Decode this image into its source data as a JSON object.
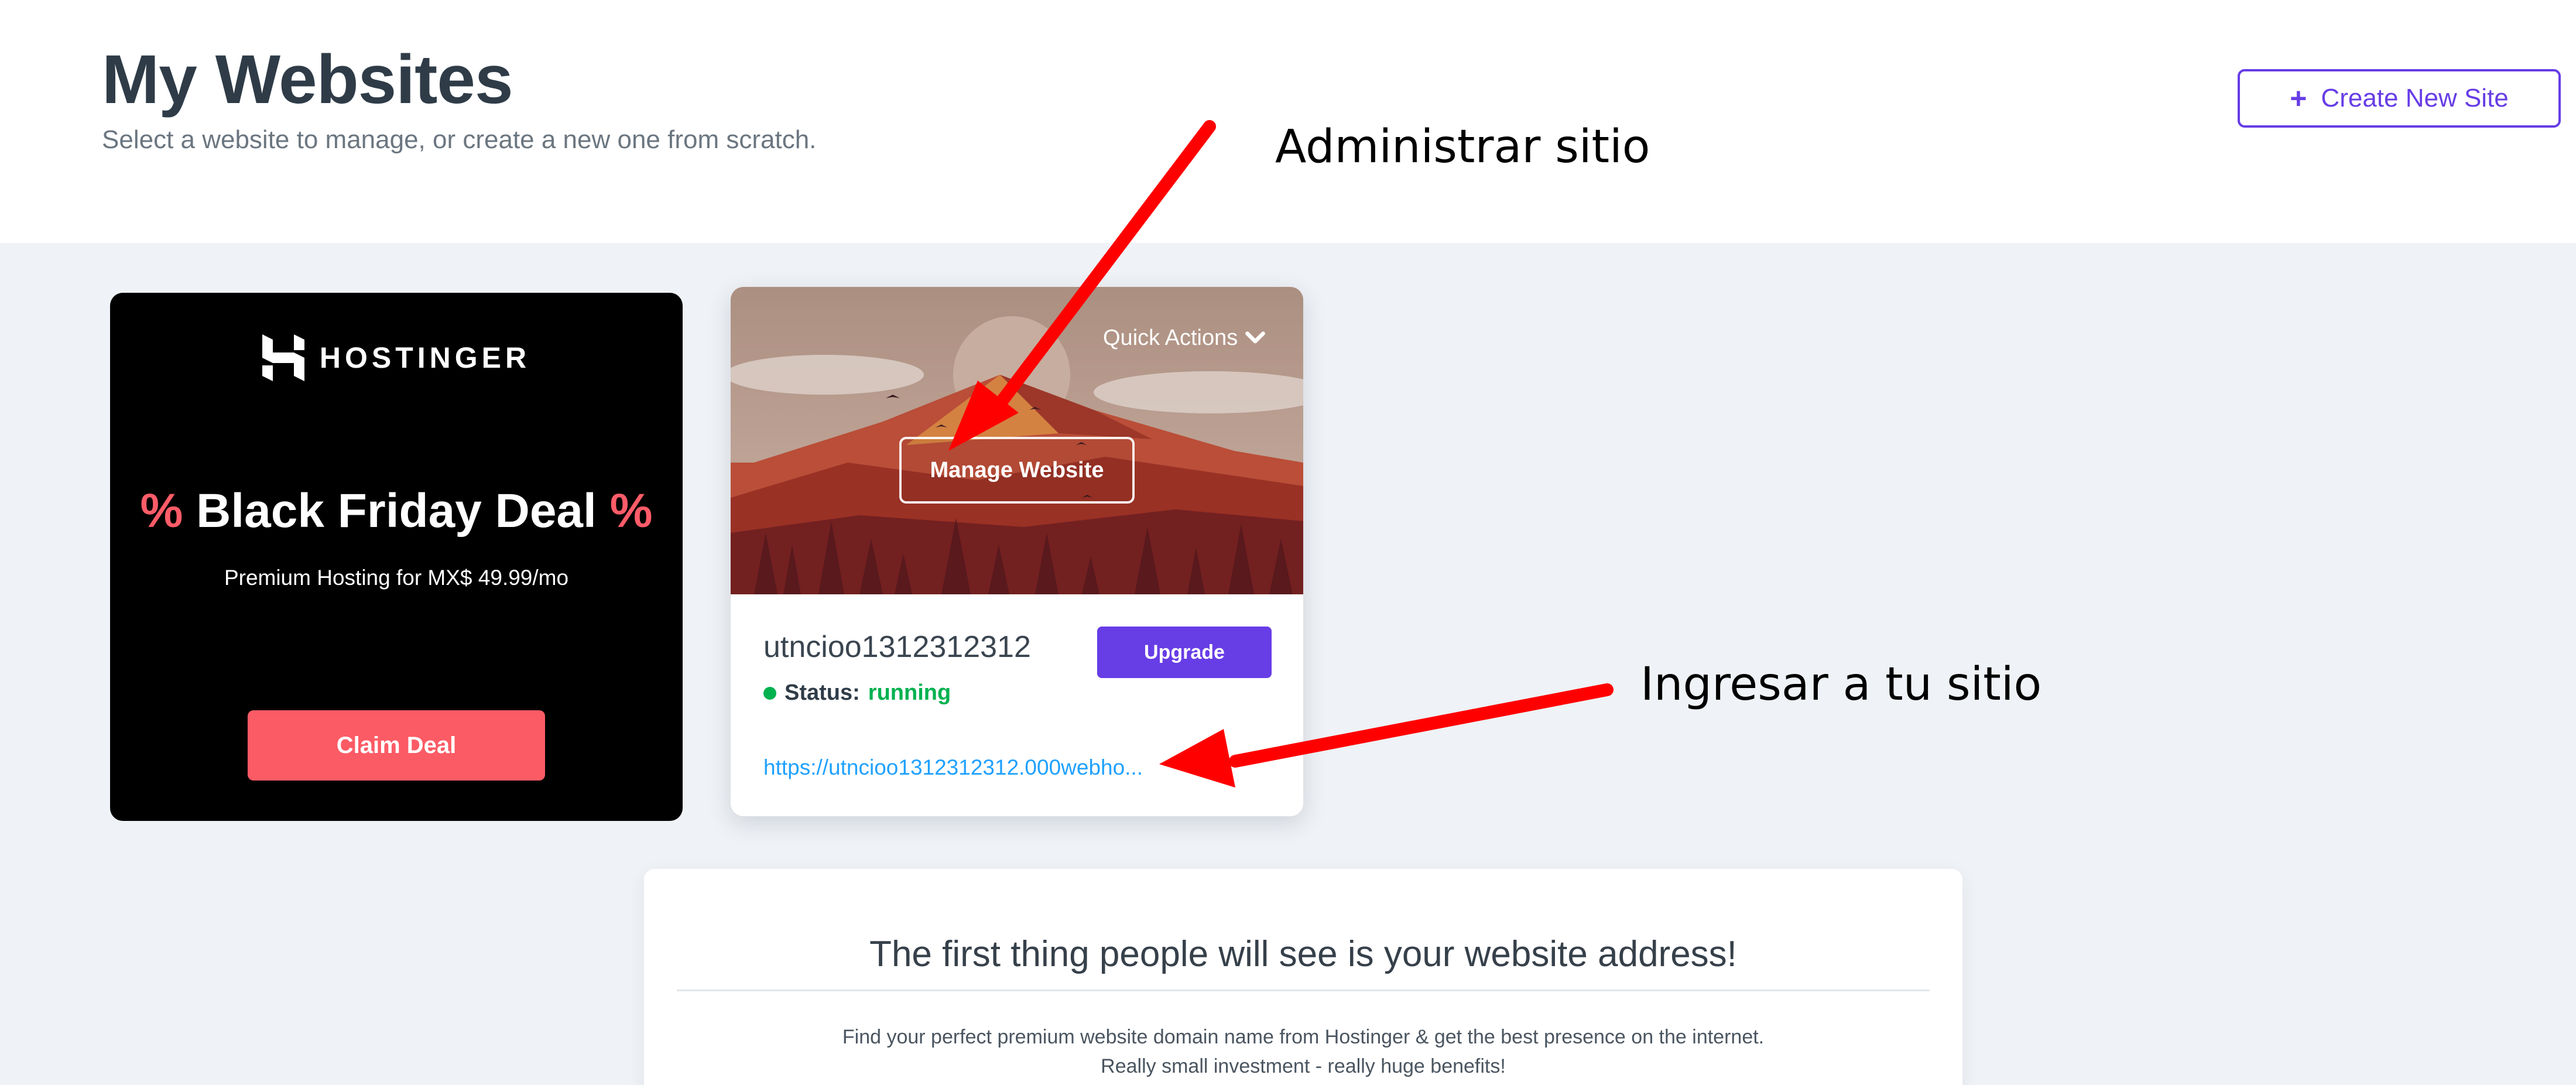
{
  "header": {
    "title": "My Websites",
    "subtitle": "Select a website to manage, or create a new one from scratch.",
    "create_button": "Create New Site",
    "create_icon": "+"
  },
  "promo": {
    "logo_text": "HOSTINGER",
    "pct_left": "%",
    "title": "Black Friday Deal",
    "pct_right": "%",
    "subtitle": "Premium Hosting for MX$ 49.99/mo",
    "cta": "Claim Deal"
  },
  "site": {
    "quick_actions": "Quick Actions",
    "manage_button": "Manage Website",
    "name": "utncioo1312312312",
    "upgrade_button": "Upgrade",
    "status_label": "Status:",
    "status_value": "running",
    "url": "https://utncioo1312312312.000webho..."
  },
  "domain_promo": {
    "title": "The first thing people will see is your website address!",
    "description": "Find your perfect premium website domain name from Hostinger & get the best presence on the internet. Really small investment - really huge benefits!"
  },
  "annotations": {
    "manage": "Administrar sitio",
    "visit": "Ingresar a tu sitio"
  },
  "colors": {
    "accent": "#673de6",
    "promo_red": "#fb5b65",
    "status_green": "#00b14f",
    "link_blue": "#1fa1ff",
    "arrow_red": "#ff0000"
  },
  "icons": {
    "logo": "hostinger-logo-icon",
    "chevron": "chevron-down-icon",
    "status": "status-dot-icon"
  }
}
